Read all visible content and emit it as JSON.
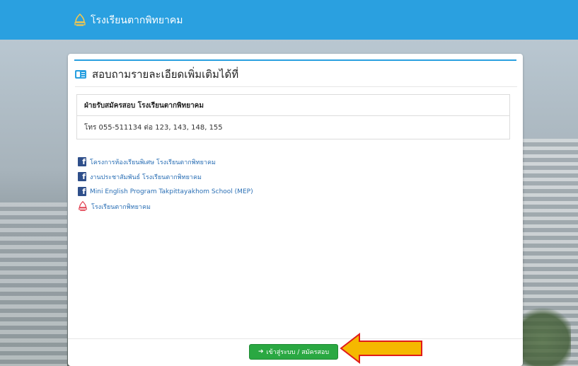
{
  "navbar": {
    "brand_text": "โรงเรียนตากพิทยาคม",
    "brand_icon": "school-logo-icon",
    "color": "#2aa0e0"
  },
  "card": {
    "title": "สอบถามรายละเอียดเพิ่มเติมได้ที่",
    "title_icon": "contact-card-icon",
    "info": {
      "heading": "ฝ่ายรับสมัครสอบ โรงเรียนตากพิทยาคม",
      "phone": "โทร 055-511134 ต่อ 123, 143, 148, 155"
    },
    "links": [
      {
        "label": "โครงการห้องเรียนพิเศษ โรงเรียนตากพิทยาคม",
        "icon": "facebook-icon"
      },
      {
        "label": "งานประชาสัมพันธ์ โรงเรียนตากพิทยาคม",
        "icon": "facebook-icon"
      },
      {
        "label": "Mini English Program Takpittayakhom School (MEP)",
        "icon": "facebook-icon"
      },
      {
        "label": "โรงเรียนตากพิทยาคม",
        "icon": "school-logo-icon"
      }
    ],
    "submit_button": {
      "label": "เข้าสู่ระบบ / สมัครสอบ",
      "icon": "login-icon",
      "color": "#2aa842"
    }
  },
  "annotation": {
    "arrow_color": "#f5b800",
    "arrow_outline": "#e01b1b"
  }
}
